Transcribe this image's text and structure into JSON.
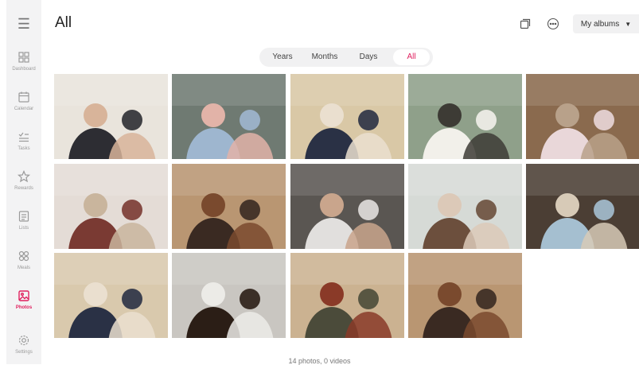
{
  "header": {
    "title": "All",
    "albums_label": "My albums"
  },
  "tabs": [
    {
      "label": "Years"
    },
    {
      "label": "Months"
    },
    {
      "label": "Days"
    },
    {
      "label": "All",
      "active": true
    }
  ],
  "sidebar": {
    "items": [
      {
        "label": "Dashboard",
        "icon": "dashboard-icon"
      },
      {
        "label": "Calendar",
        "icon": "calendar-icon"
      },
      {
        "label": "Tasks",
        "icon": "tasks-icon"
      },
      {
        "label": "Rewards",
        "icon": "star-icon"
      },
      {
        "label": "Lists",
        "icon": "list-icon"
      },
      {
        "label": "Meals",
        "icon": "meals-icon"
      },
      {
        "label": "Photos",
        "icon": "photo-icon",
        "active": true
      },
      {
        "label": "Settings",
        "icon": "gear-icon"
      }
    ]
  },
  "footer": {
    "count_text": "14 photos, 0 videos"
  },
  "colors": {
    "accent": "#e0215f",
    "sidebar_bg": "#f3f3f4",
    "pill_bg": "#f1f1f2"
  },
  "photos": [
    {
      "bg": "#e9e4dc",
      "a": "#2d2d33",
      "b": "#d8b49a"
    },
    {
      "bg": "#6f7a72",
      "a": "#9eb6cf",
      "b": "#e2b3a8"
    },
    {
      "bg": "#d9c8a6",
      "a": "#2a3145",
      "b": "#eadfcf"
    },
    {
      "bg": "#8fa08a",
      "a": "#f2f0ea",
      "b": "#3d3b35"
    },
    {
      "bg": "#8a6a4e",
      "a": "#e9d7d9",
      "b": "#b8a18a"
    },
    {
      "bg": "#e4dcd6",
      "a": "#7a3a33",
      "b": "#c9b59d"
    },
    {
      "bg": "#b99672",
      "a": "#3a2a22",
      "b": "#7a4a2e"
    },
    {
      "bg": "#5a5652",
      "a": "#e1dfdd",
      "b": "#c9a58c"
    },
    {
      "bg": "#d6dad6",
      "a": "#6c4f3d",
      "b": "#dcc9b8"
    },
    {
      "bg": "#4b3e34",
      "a": "#a5bfd0",
      "b": "#d7cab7"
    },
    {
      "bg": "#d9c9ad",
      "a": "#2a3145",
      "b": "#eadfcf"
    },
    {
      "bg": "#c9c6c1",
      "a": "#2b1e16",
      "b": "#ecebe7"
    },
    {
      "bg": "#cbb291",
      "a": "#4b4b3a",
      "b": "#8a3a28"
    },
    {
      "bg": "#b99672",
      "a": "#3a2a22",
      "b": "#7a4a2e"
    }
  ]
}
